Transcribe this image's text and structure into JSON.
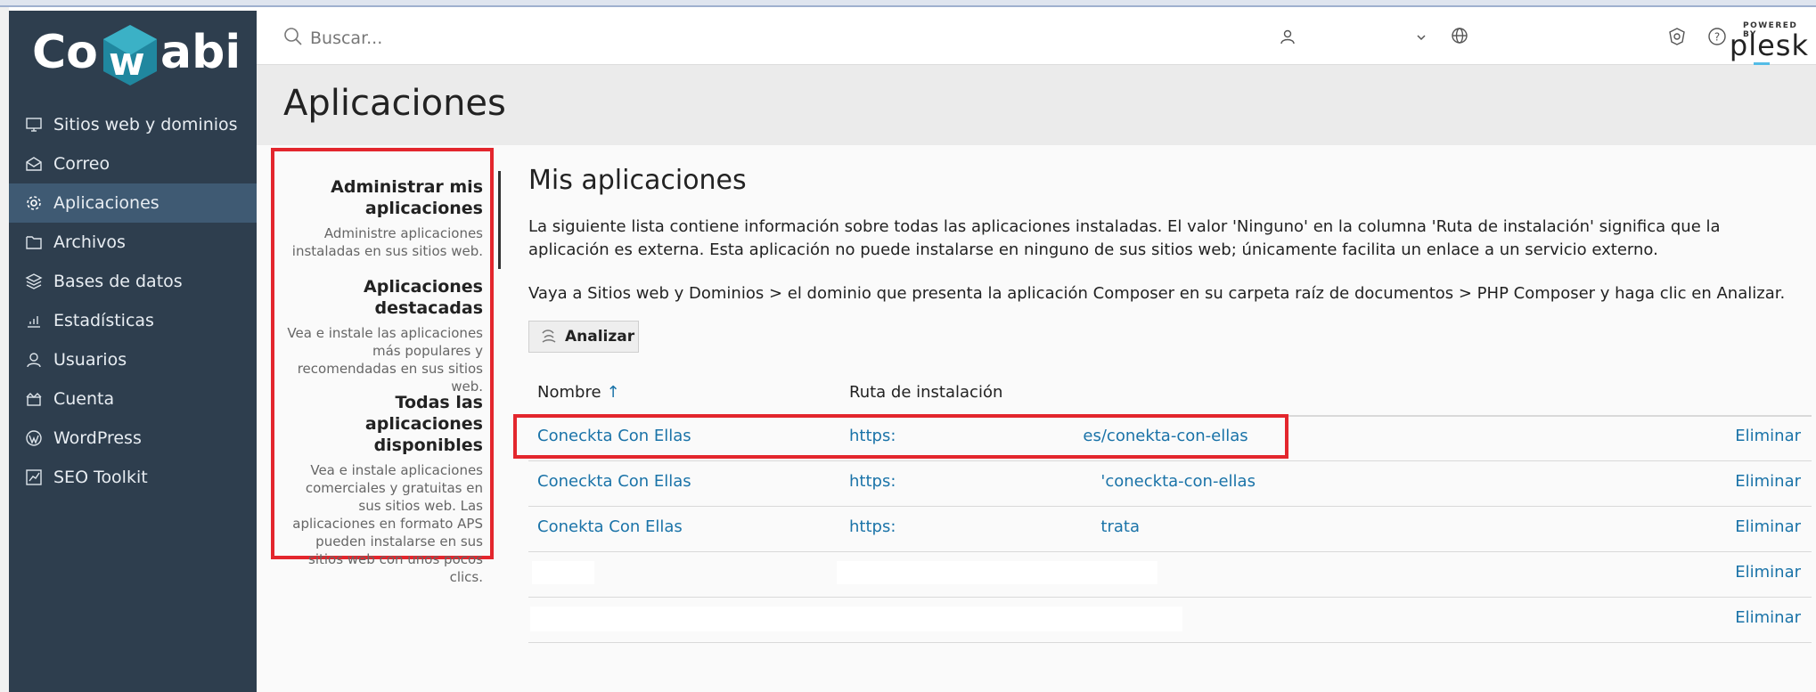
{
  "brand": {
    "logo_text": "Cowabi",
    "colors": {
      "sidebar": "#2e3e4e",
      "active": "#3f5a73",
      "link": "#1a73a8",
      "highlight": "#e3262d"
    }
  },
  "sidebar": {
    "items": [
      {
        "label": "Sitios web y dominios",
        "icon": "monitor-icon"
      },
      {
        "label": "Correo",
        "icon": "mail-icon"
      },
      {
        "label": "Aplicaciones",
        "icon": "gear-icon",
        "active": true
      },
      {
        "label": "Archivos",
        "icon": "folder-icon"
      },
      {
        "label": "Bases de datos",
        "icon": "database-icon"
      },
      {
        "label": "Estadísticas",
        "icon": "bar-chart-icon"
      },
      {
        "label": "Usuarios",
        "icon": "user-icon"
      },
      {
        "label": "Cuenta",
        "icon": "account-icon"
      },
      {
        "label": "WordPress",
        "icon": "wordpress-icon"
      },
      {
        "label": "SEO Toolkit",
        "icon": "seo-chart-icon"
      }
    ],
    "collapse_glyph": "‹"
  },
  "topbar": {
    "search_placeholder": "Buscar...",
    "plesk_powered": "POWERED BY",
    "plesk_word": "plesk"
  },
  "page": {
    "title": "Aplicaciones"
  },
  "subnav": {
    "sections": [
      {
        "heading": "Administrar mis aplicaciones",
        "desc": "Administre aplicaciones instaladas en sus sitios web."
      },
      {
        "heading": "Aplicaciones destacadas",
        "desc": "Vea e instale las aplicaciones más populares y recomendadas en sus sitios web."
      },
      {
        "heading": "Todas las aplicaciones disponibles",
        "desc": "Vea e instale aplicaciones comerciales y gratuitas en sus sitios web. Las aplicaciones en formato APS pueden instalarse en sus sitios web con unos pocos clics."
      }
    ]
  },
  "main": {
    "title": "Mis aplicaciones",
    "description": "La siguiente lista contiene información sobre todas las aplicaciones instaladas. El valor 'Ninguno' en la columna 'Ruta de instalación' significa que la aplicación es externa. Esta aplicación no puede instalarse en ninguno de sus sitios web; únicamente facilita un enlace a un servicio externo.",
    "instruction": "Vaya a Sitios web y Dominios > el dominio que presenta la aplicación Composer en su carpeta raíz de documentos > PHP Composer y haga clic en Analizar.",
    "analyze_label": "Analizar",
    "table": {
      "col_name": "Nombre",
      "sort_arrow": "↑",
      "col_path": "Ruta de instalación",
      "rows": [
        {
          "name": "Coneckta Con Ellas",
          "path_start": "https:",
          "path_end": "es/conekta-con-ellas",
          "action": "Eliminar"
        },
        {
          "name": "Coneckta Con Ellas",
          "path_start": "https:",
          "path_end": "'coneckta-con-ellas",
          "action": "Eliminar"
        },
        {
          "name": "Conekta Con Ellas",
          "path_start": "https:",
          "path_end": "trata",
          "action": "Eliminar"
        },
        {
          "name": "",
          "path_start": "",
          "path_end": "",
          "action": "Eliminar"
        },
        {
          "name": "",
          "path_start": "",
          "path_end": "",
          "action": "Eliminar"
        }
      ]
    }
  }
}
